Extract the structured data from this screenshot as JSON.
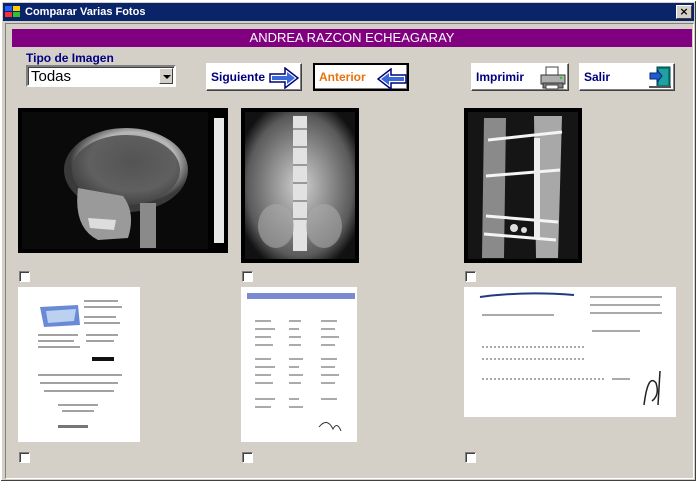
{
  "window": {
    "title": "Comparar Varias Fotos",
    "close_glyph": "×"
  },
  "patient": {
    "name": "ANDREA RAZCON ECHEAGARAY"
  },
  "filter": {
    "label": "Tipo de Imagen",
    "selected": "Todas"
  },
  "buttons": {
    "next": "Siguiente",
    "prev": "Anterior",
    "print": "Imprimir",
    "exit": "Salir"
  },
  "icons": {
    "next": "arrow-right-icon",
    "prev": "arrow-left-icon",
    "print": "printer-icon",
    "exit": "exit-door-icon"
  },
  "photos": [
    {
      "kind": "xray-skull",
      "checked": false
    },
    {
      "kind": "xray-spine",
      "checked": false
    },
    {
      "kind": "xray-leg-fixation",
      "checked": false
    },
    {
      "kind": "document-lab-report",
      "checked": false
    },
    {
      "kind": "document-results-table",
      "checked": false
    },
    {
      "kind": "document-receipt",
      "checked": false
    }
  ],
  "colors": {
    "title_bar": "#0a246a",
    "patient_bar": "#800080",
    "label_blue": "#000080",
    "focus_label": "#e8740e"
  }
}
